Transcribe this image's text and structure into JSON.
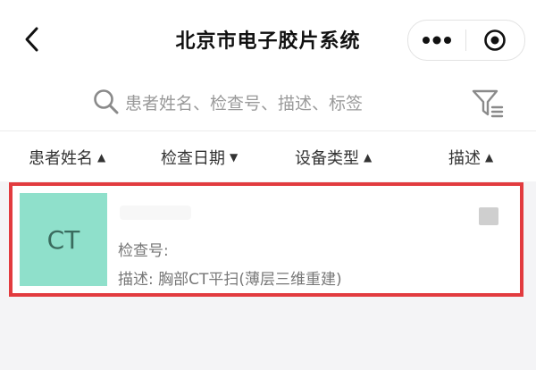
{
  "header": {
    "title": "北京市电子胶片系统",
    "back_icon": "chevron-left-icon",
    "more_icon": "more-dots-icon",
    "target_icon": "target-icon"
  },
  "search": {
    "placeholder": "患者姓名、检查号、描述、标签",
    "search_icon": "search-icon",
    "filter_icon": "filter-icon"
  },
  "columns": [
    {
      "label": "患者姓名",
      "sort": "▲"
    },
    {
      "label": "检查日期",
      "sort": "▼"
    },
    {
      "label": "设备类型",
      "sort": "▲"
    },
    {
      "label": "描述",
      "sort": "▲"
    }
  ],
  "record": {
    "modality": "CT",
    "exam_no_label": "检查号:",
    "description": "描述: 胸部CT平扫(薄层三维重建)",
    "badge_color": "#8fe0cb",
    "highlight_color": "#e23b3f"
  }
}
